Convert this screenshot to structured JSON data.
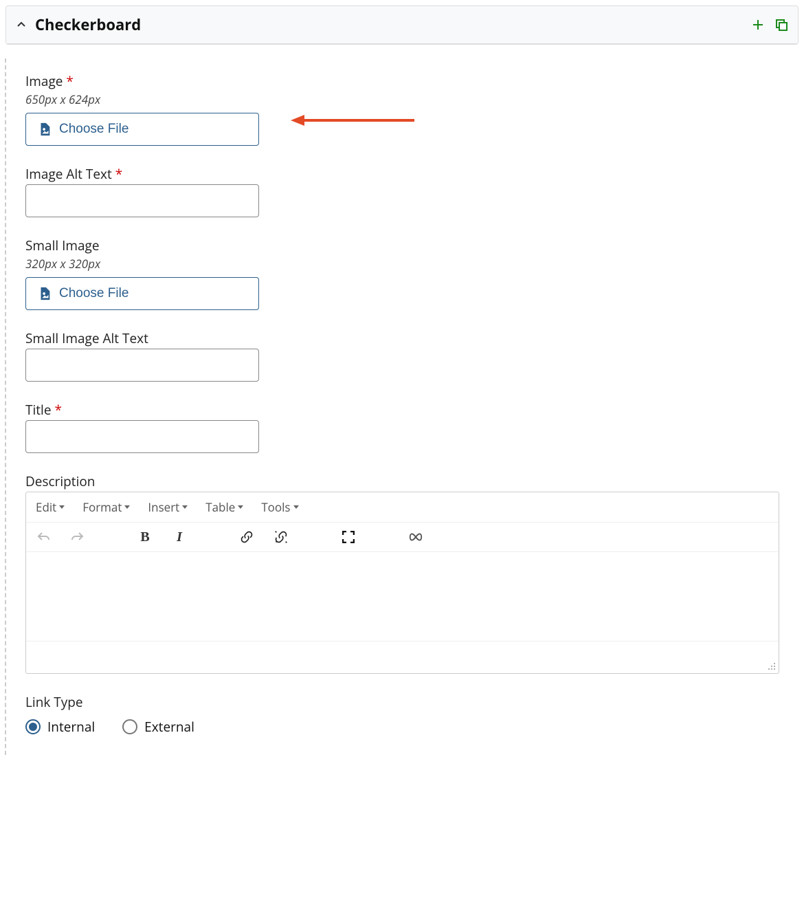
{
  "panel": {
    "title": "Checkerboard"
  },
  "fields": {
    "image": {
      "label": "Image",
      "required_marker": "*",
      "hint": "650px x 624px",
      "button": "Choose File"
    },
    "image_alt": {
      "label": "Image Alt Text",
      "required_marker": "*",
      "value": ""
    },
    "small_image": {
      "label": "Small Image",
      "hint": "320px x 320px",
      "button": "Choose File"
    },
    "small_image_alt": {
      "label": "Small Image Alt Text",
      "value": ""
    },
    "title": {
      "label": "Title",
      "required_marker": "*",
      "value": ""
    },
    "description": {
      "label": "Description",
      "value": ""
    },
    "link_type": {
      "label": "Link Type",
      "options": {
        "internal": "Internal",
        "external": "External"
      },
      "selected": "internal"
    }
  },
  "editor": {
    "menus": {
      "edit": "Edit",
      "format": "Format",
      "insert": "Insert",
      "table": "Table",
      "tools": "Tools"
    }
  },
  "colors": {
    "accent": "#2c5f8d",
    "success": "#1b8a1b",
    "annotation": "#e34a26"
  }
}
